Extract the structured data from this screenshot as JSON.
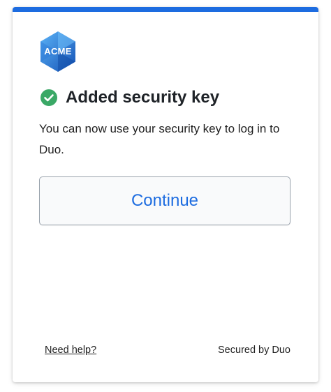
{
  "colors": {
    "accent": "#1d6ce0",
    "success": "#3aa866",
    "logo_light": "#4aa0f0",
    "logo_dark": "#1a5fc0"
  },
  "logo": {
    "text": "ACME",
    "icon": "hexagon-logo"
  },
  "status": {
    "icon": "check-circle-icon",
    "title": "Added security key"
  },
  "message": "You can now use your security key to log in to Duo.",
  "continue_label": "Continue",
  "footer": {
    "help_label": "Need help?",
    "secured_label": "Secured by Duo"
  }
}
